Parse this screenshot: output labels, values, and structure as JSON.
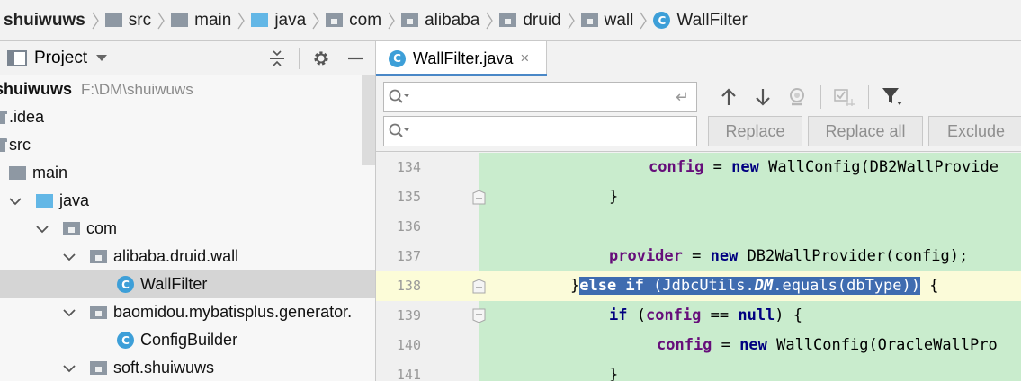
{
  "breadcrumb": {
    "project": "shuiwuws",
    "items": [
      "src",
      "main",
      "java",
      "com",
      "alibaba",
      "druid",
      "wall"
    ],
    "file": "WallFilter"
  },
  "project_panel": {
    "title": "Project",
    "tree": [
      {
        "label": "shuiwuws",
        "path": "F:\\DM\\shuiwuws"
      },
      {
        "label": ".idea"
      },
      {
        "label": "src"
      },
      {
        "label": "main"
      },
      {
        "label": "java"
      },
      {
        "label": "com"
      },
      {
        "label": "alibaba.druid.wall"
      },
      {
        "label": "WallFilter"
      },
      {
        "label": "baomidou.mybatisplus.generator."
      },
      {
        "label": "ConfigBuilder"
      },
      {
        "label": "soft.shuiwuws"
      }
    ]
  },
  "editor": {
    "tab_label": "WallFilter.java",
    "tab_close": "×",
    "search_value": "",
    "replace_value": "",
    "buttons": {
      "replace": "Replace",
      "replace_all": "Replace all",
      "exclude": "Exclude"
    },
    "enter_glyph": "↵",
    "lines": [
      {
        "num": "134"
      },
      {
        "num": "135"
      },
      {
        "num": "136"
      },
      {
        "num": "137"
      },
      {
        "num": "138"
      },
      {
        "num": "139"
      },
      {
        "num": "140"
      },
      {
        "num": "141"
      }
    ],
    "tokens": {
      "config": "config",
      "eq": " = ",
      "new": "new",
      "wall_config_db2": " WallConfig(DB2WallProvide",
      "close_brace": "}",
      "provider": "provider",
      "db2_provider": " DB2WallProvider(config);",
      "sel_else": "else if",
      "sel_mid": " (JdbcUtils.",
      "sel_dm": "DM",
      "sel_equals": ".equals(dbType))",
      "open_brace": " {",
      "if": "if",
      "if_paren": " (",
      "eqeq": " == ",
      "null": "null",
      "paren_brace": ") {",
      "oracle_config": " WallConfig(OracleWallPro"
    }
  },
  "colors": {
    "accent": "#4a88c7",
    "selection": "#3f6cb0",
    "code_bg": "#c9eccd",
    "current_line": "#fbfbd9",
    "keyword": "#000080",
    "field": "#660e7a"
  }
}
